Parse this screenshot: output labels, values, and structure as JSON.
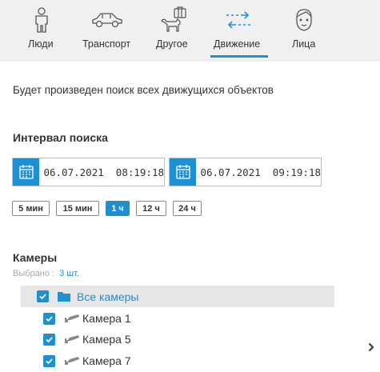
{
  "tabs": [
    {
      "label": "Люди",
      "icon": "person-icon",
      "active": false
    },
    {
      "label": "Транспорт",
      "icon": "car-icon",
      "active": false
    },
    {
      "label": "Другое",
      "icon": "dog-suitcase-icon",
      "active": false
    },
    {
      "label": "Движение",
      "icon": "motion-arrows-icon",
      "active": true
    },
    {
      "label": "Лица",
      "icon": "face-icon",
      "active": false
    }
  ],
  "description": "Будет произведен поиск всех движущихся объектов",
  "interval": {
    "title": "Интервал поиска",
    "from": "06.07.2021  08:19:18",
    "to": "06.07.2021  09:19:18",
    "quick": [
      {
        "label": "5 мин",
        "active": false
      },
      {
        "label": "15 мин",
        "active": false
      },
      {
        "label": "1 ч",
        "active": true
      },
      {
        "label": "12 ч",
        "active": false
      },
      {
        "label": "24 ч",
        "active": false
      }
    ]
  },
  "cameras": {
    "title": "Камеры",
    "selected_label": "Выбрано :",
    "selected_count": "3 шт.",
    "all_label": "Все камеры",
    "items": [
      {
        "label": "Камера 1",
        "checked": true
      },
      {
        "label": "Камера 5",
        "checked": true
      },
      {
        "label": "Камера 7",
        "checked": true
      }
    ]
  },
  "colors": {
    "accent": "#1e8fd0",
    "tabbar_bg": "#f0f0f0",
    "row_highlight": "#e6e6e6"
  }
}
